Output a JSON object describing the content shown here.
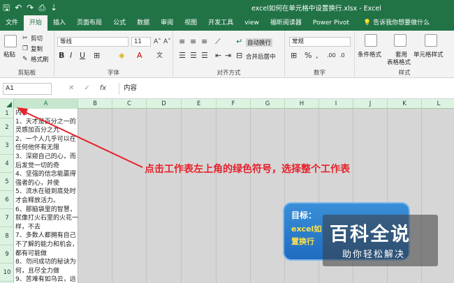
{
  "window": {
    "title": "excel如何在单元格中设置换行.xlsx - Excel",
    "qat_icons": [
      "save-icon",
      "undo-icon",
      "redo-icon",
      "print-preview-icon",
      "customize-icon"
    ]
  },
  "tabs": [
    "文件",
    "开始",
    "插入",
    "页面布局",
    "公式",
    "数据",
    "审阅",
    "视图",
    "开发工具",
    "view",
    "福昕阅读器",
    "Power Pivot"
  ],
  "tell_me": "告诉我你想要做什么",
  "ribbon": {
    "clipboard": {
      "label": "剪贴板",
      "paste": "粘贴",
      "cut": "剪切",
      "copy": "复制",
      "format_painter": "格式刷"
    },
    "font": {
      "label": "字体",
      "font_name": "等线",
      "font_size": "11"
    },
    "alignment": {
      "label": "对齐方式",
      "wrap_text": "自动换行",
      "merge_center": "合并后居中"
    },
    "number": {
      "label": "数字",
      "format": "常规"
    },
    "styles": {
      "label": "样式",
      "conditional": "条件格式",
      "table": "套用",
      "table2": "表格格式",
      "cell_styles": "单元格样式"
    }
  },
  "formula_bar": {
    "name_box": "A1",
    "content": "内容"
  },
  "grid": {
    "columns": [
      "A",
      "B",
      "C",
      "D",
      "E",
      "F",
      "G",
      "H",
      "I",
      "J",
      "K",
      "L"
    ],
    "rows": [
      "1",
      "2",
      "3",
      "4",
      "5",
      "6",
      "7",
      "8",
      "9",
      "10"
    ],
    "cell_a_text": "内容\n1、天才是百分之一的灵感加百分之九\n2、一个人几乎可以在任何他怀有无限\n3、深窥自己的心，而后发觉一切的奇\n4、坚强的信念能赢得强者的心，并使\n5、流水在碰到底处时才会释放活力。\n6、那脑袋里的智慧，就像打火石里的火花一样，不去\n7、多数人都拥有自己不了解的能力和机会，都有可能做\n8、勿问成功的秘诀为何，且尽全力做\n9、苦难有如乌云，远望去但见墨黑一"
  },
  "annotation": "点击工作表左上角的绿色符号，选择整个工作表",
  "goal_box": {
    "title": "目标：",
    "line1": "excel如",
    "line2": "置换行"
  },
  "watermark": {
    "logo": "百科全说",
    "sub": "助你轻松解决"
  },
  "colors": {
    "brand": "#217346",
    "annotation": "#e8202a",
    "goal_bg": "#2a7dd0"
  }
}
